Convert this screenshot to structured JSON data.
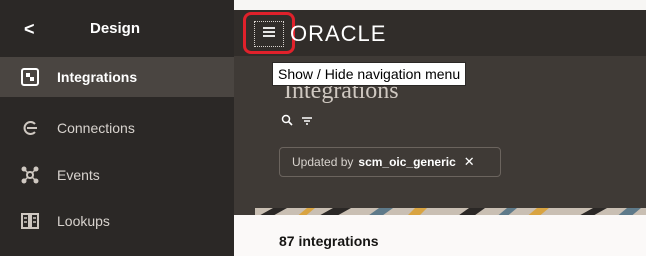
{
  "sidebar": {
    "back_label": "<",
    "title": "Design",
    "items": [
      {
        "label": "Integrations",
        "icon": "integrations-icon",
        "active": true
      },
      {
        "label": "Connections",
        "icon": "connections-icon",
        "active": false
      },
      {
        "label": "Events",
        "icon": "events-icon",
        "active": false
      },
      {
        "label": "Lookups",
        "icon": "lookups-icon",
        "active": false
      }
    ]
  },
  "header": {
    "menu_icon": "hamburger-icon",
    "logo": "ORACLE",
    "tooltip": "Show / Hide navigation menu"
  },
  "main": {
    "title": "Integrations",
    "search_icon": "search-icon",
    "filter_icon": "filter-icon",
    "filter_chip": {
      "label": "Updated by",
      "value": "scm_oic_generic",
      "remove": "✕"
    },
    "count_text": "87 integrations"
  },
  "colors": {
    "sidebar_bg": "#2b2826",
    "header_bg": "#312d2a",
    "highlight_red": "#e0212b",
    "active_bg": "#4a4541"
  }
}
